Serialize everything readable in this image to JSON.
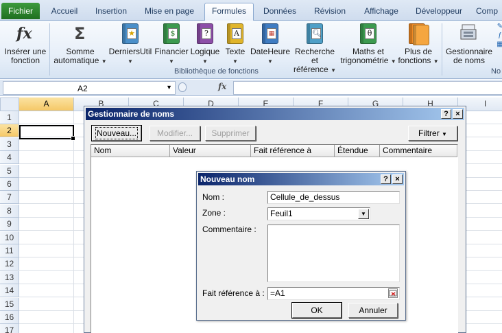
{
  "ribbon_tabs": [
    "Fichier",
    "Accueil",
    "Insertion",
    "Mise en page",
    "Formules",
    "Données",
    "Révision",
    "Affichage",
    "Développeur",
    "Comp"
  ],
  "active_tab": "Formules",
  "ribbon": {
    "insert_function": {
      "line1": "Insérer une",
      "line2": "fonction"
    },
    "autosum": {
      "line1": "Somme",
      "line2": "automatique"
    },
    "library": [
      {
        "label": "DerniersUtil",
        "icon": "recently-used-book-icon",
        "color": "#4a8fc9"
      },
      {
        "label": "Financier",
        "icon": "financial-book-icon",
        "color": "#3c9a4f"
      },
      {
        "label": "Logique",
        "icon": "logical-book-icon",
        "color": "#8d4fa8",
        "glyph": "?"
      },
      {
        "label": "Texte",
        "icon": "text-book-icon",
        "color": "#e0b52c",
        "glyph": "A"
      },
      {
        "label": "DateHeure",
        "icon": "date-time-book-icon",
        "color": "#3f7cc2"
      }
    ],
    "lookup": {
      "line1": "Recherche et",
      "line2": "référence"
    },
    "math": {
      "line1": "Maths et",
      "line2": "trigonométrie"
    },
    "more": {
      "line1": "Plus de",
      "line2": "fonctions"
    },
    "group_library_label": "Bibliothèque de fonctions",
    "name_manager": {
      "line1": "Gestionnaire",
      "line2": "de noms"
    },
    "group_partial_label": "No"
  },
  "formula_bar": {
    "name_box": "A2",
    "fx": "fx",
    "formula": ""
  },
  "grid": {
    "columns": [
      "A",
      "B",
      "C",
      "D",
      "E",
      "F",
      "G",
      "H",
      "I"
    ],
    "rows": [
      "1",
      "2",
      "3",
      "4",
      "5",
      "6",
      "7",
      "8",
      "9",
      "10",
      "11",
      "12",
      "13",
      "14",
      "15",
      "16",
      "17"
    ],
    "selected_column": "A",
    "selected_row": "2"
  },
  "name_manager_dialog": {
    "title": "Gestionnaire de noms",
    "help": "?",
    "close": "×",
    "buttons": {
      "new": "Nouveau...",
      "edit": "Modifier...",
      "delete": "Supprimer",
      "filter": "Filtrer"
    },
    "columns": [
      "Nom",
      "Valeur",
      "Fait référence à",
      "Étendue",
      "Commentaire"
    ]
  },
  "new_name_dialog": {
    "title": "Nouveau nom",
    "help": "?",
    "close": "×",
    "name_label": "Nom :",
    "name_value": "Cellule_de_dessus",
    "scope_label": "Zone :",
    "scope_value": "Feuil1",
    "comment_label": "Commentaire :",
    "comment_value": "",
    "refers_label": "Fait référence à :",
    "refers_value": "=A1",
    "ok": "OK",
    "cancel": "Annuler"
  }
}
